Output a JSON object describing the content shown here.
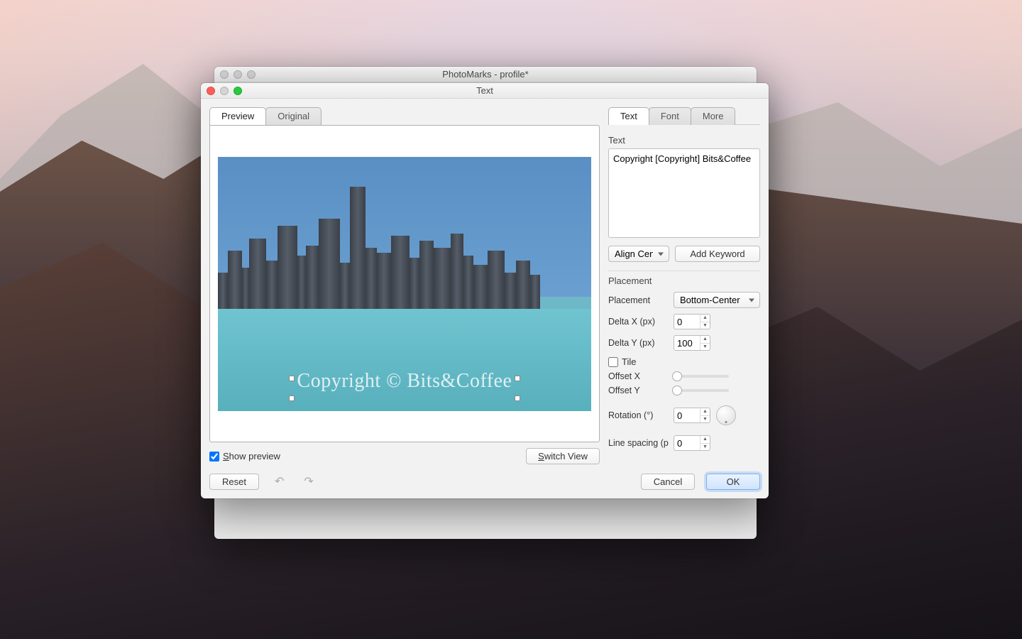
{
  "parent_window": {
    "title": "PhotoMarks - profile*"
  },
  "dialog": {
    "title": "Text",
    "left": {
      "tabs": {
        "preview": "Preview",
        "original": "Original"
      },
      "watermark_preview": "Copyright © Bits&Coffee",
      "show_preview_label": "Show preview",
      "show_preview_checked": true,
      "switch_view": "Switch View",
      "reset": "Reset"
    },
    "right": {
      "tabs": {
        "text": "Text",
        "font": "Font",
        "more": "More"
      },
      "text_label": "Text",
      "text_value": "Copyright [Copyright] Bits&Coffee",
      "align_select": "Align Center",
      "add_keyword": "Add Keyword",
      "placement_header": "Placement",
      "placement_label": "Placement",
      "placement_value": "Bottom-Center",
      "deltax_label": "Delta X (px)",
      "deltax_value": "0",
      "deltay_label": "Delta Y (px)",
      "deltay_value": "100",
      "tile_label": "Tile",
      "offsetx_label": "Offset X",
      "offsety_label": "Offset Y",
      "rotation_label": "Rotation (°)",
      "rotation_value": "0",
      "linespacing_label": "Line spacing (p",
      "linespacing_value": "0"
    },
    "buttons": {
      "cancel": "Cancel",
      "ok": "OK"
    }
  }
}
